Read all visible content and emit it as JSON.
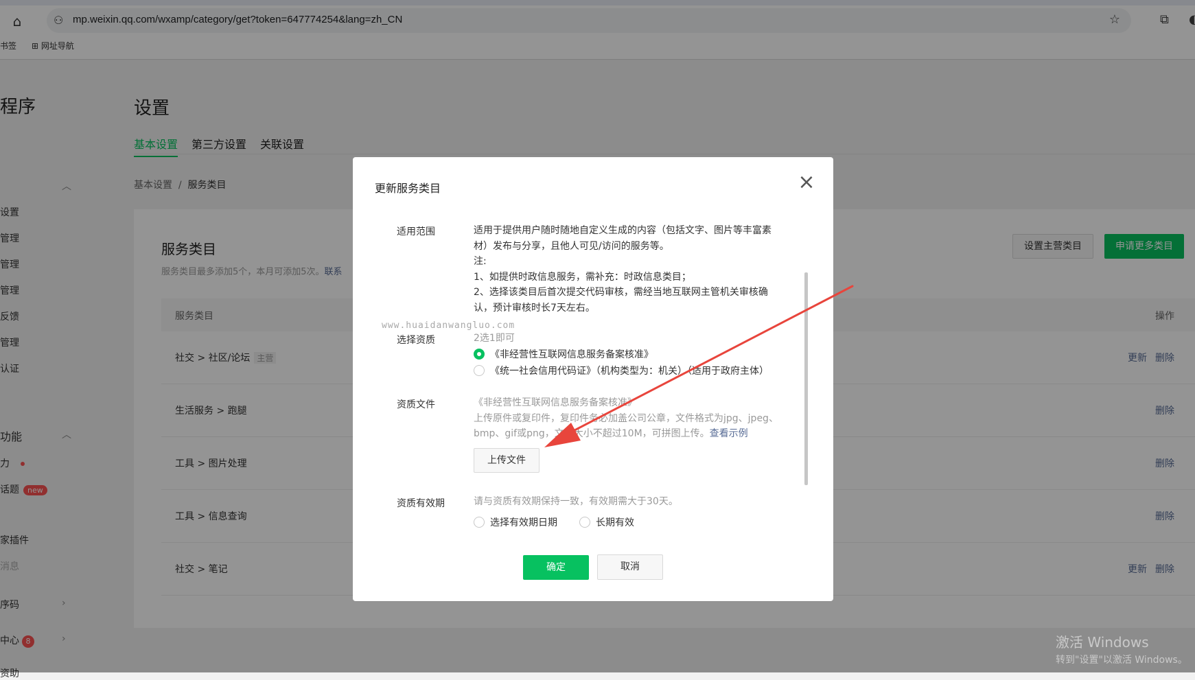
{
  "browser": {
    "url": "mp.weixin.qq.com/wxamp/category/get?token=647774254&lang=zh_CN",
    "bookmarks": [
      "书签",
      "网址导航"
    ]
  },
  "sidebar": {
    "brand": "程序",
    "items": [
      "设置",
      "管理",
      "管理",
      "管理",
      "反馈",
      "管理",
      "认证"
    ],
    "section2": "功能",
    "items2": [
      "力",
      "话题",
      "家插件",
      "消息",
      "序码",
      "中心",
      "资助"
    ],
    "badge_new": "new",
    "badge_count": "8"
  },
  "main": {
    "title": "设置",
    "tabs": [
      "基本设置",
      "第三方设置",
      "关联设置"
    ],
    "breadcrumb": [
      "基本设置",
      "/",
      "服务类目"
    ],
    "card": {
      "title": "服务类目",
      "subtitle": "服务类目最多添加5个，本月可添加5次。",
      "subtitle_link": "联系",
      "btn_set_main": "设置主营类目",
      "btn_apply_more": "申请更多类目",
      "col_category": "服务类目",
      "col_ops": "操作",
      "rows": [
        {
          "path": "社交  >  社区/论坛",
          "tag": "主营",
          "ops": [
            "更新",
            "删除"
          ]
        },
        {
          "path": "生活服务  >  跑腿",
          "tag": "",
          "ops": [
            "删除"
          ]
        },
        {
          "path": "工具  >  图片处理",
          "tag": "",
          "ops": [
            "删除"
          ]
        },
        {
          "path": "工具  >  信息查询",
          "tag": "",
          "ops": [
            "删除"
          ]
        },
        {
          "path": "社交  >  笔记",
          "tag": "",
          "ops": [
            "更新",
            "删除"
          ]
        }
      ]
    }
  },
  "dialog": {
    "title": "更新服务类目",
    "scope_label": "适用范围",
    "scope_lines": [
      "适用于提供用户随时随地自定义生成的内容（包括文字、图片等丰富素",
      "材）发布与分享，且他人可见/访问的服务等。",
      "注:",
      "1、如提供时政信息服务，需补充：时政信息类目；",
      "2、选择该类目后首次提交代码审核，需经当地互联网主管机关审核确",
      "认，预计审核时长7天左右。"
    ],
    "qual_label": "选择资质",
    "qual_hint": "2选1即可",
    "qual_options": [
      "《非经营性互联网信息服务备案核准》",
      "《统一社会信用代码证》（机构类型为：机关）（适用于政府主体）"
    ],
    "file_label": "资质文件",
    "file_name": "《非经营性互联网信息服务备案核准》",
    "file_desc_1": "上传原件或复印件，复印件务必加盖公司公章，文件格式为jpg、jpeg、",
    "file_desc_2": "bmp、gif或png，文件大小不超过10M，可拼图上传。",
    "file_example_link": "查看示例",
    "upload_btn": "上传文件",
    "validity_label": "资质有效期",
    "validity_hint": "请与资质有效期保持一致，有效期需大于30天。",
    "validity_options": [
      "选择有效期日期",
      "长期有效"
    ],
    "ok": "确定",
    "cancel": "取消"
  },
  "watermark": "www.huaidanwangluo.com",
  "windows_activation": {
    "line1": "激活 Windows",
    "line2": "转到\"设置\"以激活 Windows。"
  },
  "colors": {
    "accent": "#07c160",
    "link": "#576b95",
    "badge": "#fa5151",
    "annotation_arrow": "#e8453c"
  }
}
